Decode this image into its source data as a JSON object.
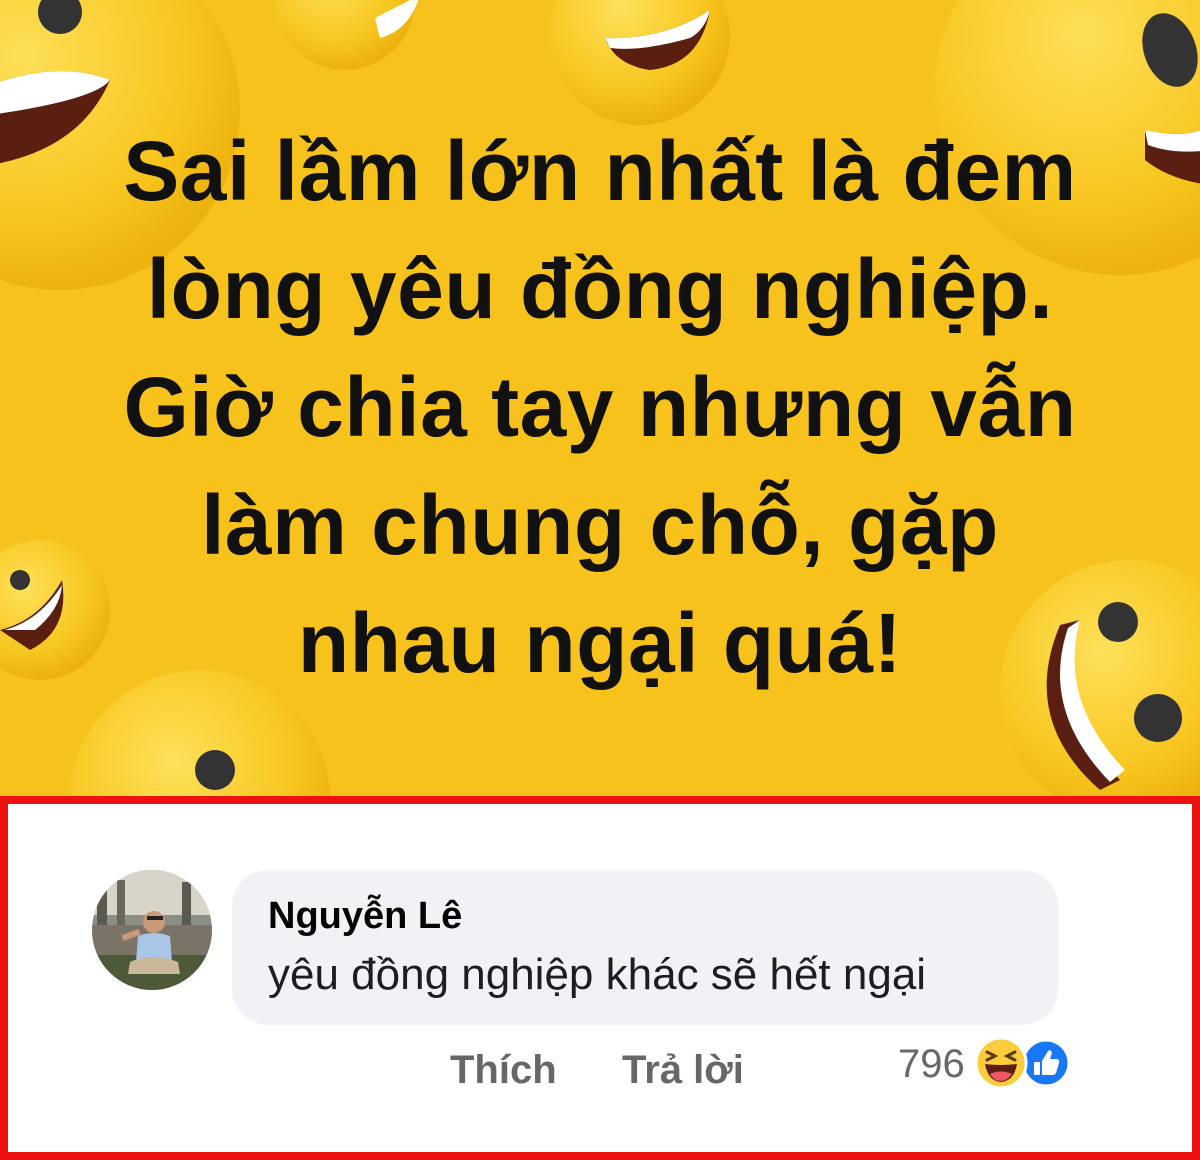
{
  "post": {
    "text_lines": [
      "Sai lầm lớn nhất là đem",
      "lòng yêu đồng nghiệp.",
      "Giờ chia tay nhưng vẫn",
      "làm chung chỗ, gặp",
      "nhau ngại quá!"
    ],
    "background_color": "#f7c21c"
  },
  "comment": {
    "author": "Nguyễn Lê",
    "text": "yêu đồng nghiệp khác sẽ hết ngại",
    "actions": {
      "like_label": "Thích",
      "reply_label": "Trả lời"
    },
    "reaction_count": "796",
    "reaction_icons": [
      "haha-icon",
      "like-icon"
    ]
  },
  "colors": {
    "highlight_border": "#ee1111",
    "bubble": "#f0f2f5",
    "action_text": "#65676b",
    "like_blue": "#1877f2"
  }
}
